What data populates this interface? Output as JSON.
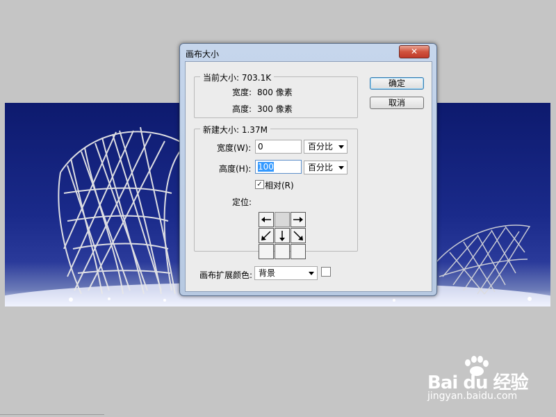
{
  "dialog": {
    "title": "画布大小",
    "close_label": "✕"
  },
  "current_size": {
    "title": "当前大小: 703.1K",
    "width_label": "宽度:",
    "width_value": "800 像素",
    "height_label": "高度:",
    "height_value": "300 像素"
  },
  "new_size": {
    "title": "新建大小: 1.37M",
    "width_label": "宽度(W):",
    "width_value": "0",
    "width_unit": "百分比",
    "height_label": "高度(H):",
    "height_value": "100",
    "height_unit": "百分比",
    "relative_label": "相对(R)",
    "relative_checked": true,
    "anchor_label": "定位:"
  },
  "canvas_ext": {
    "label": "画布扩展颜色:",
    "value": "背景"
  },
  "buttons": {
    "ok": "确定",
    "cancel": "取消"
  },
  "watermark": {
    "main": "Bai du 经验",
    "sub": "jingyan.baidu.com"
  },
  "icons": {
    "close": "close-icon",
    "checkbox": "check-icon",
    "anchor_arrows": [
      "arrow-left-icon",
      "",
      "arrow-right-icon",
      "arrow-down-left-icon",
      "arrow-down-icon",
      "arrow-down-right-icon"
    ]
  }
}
